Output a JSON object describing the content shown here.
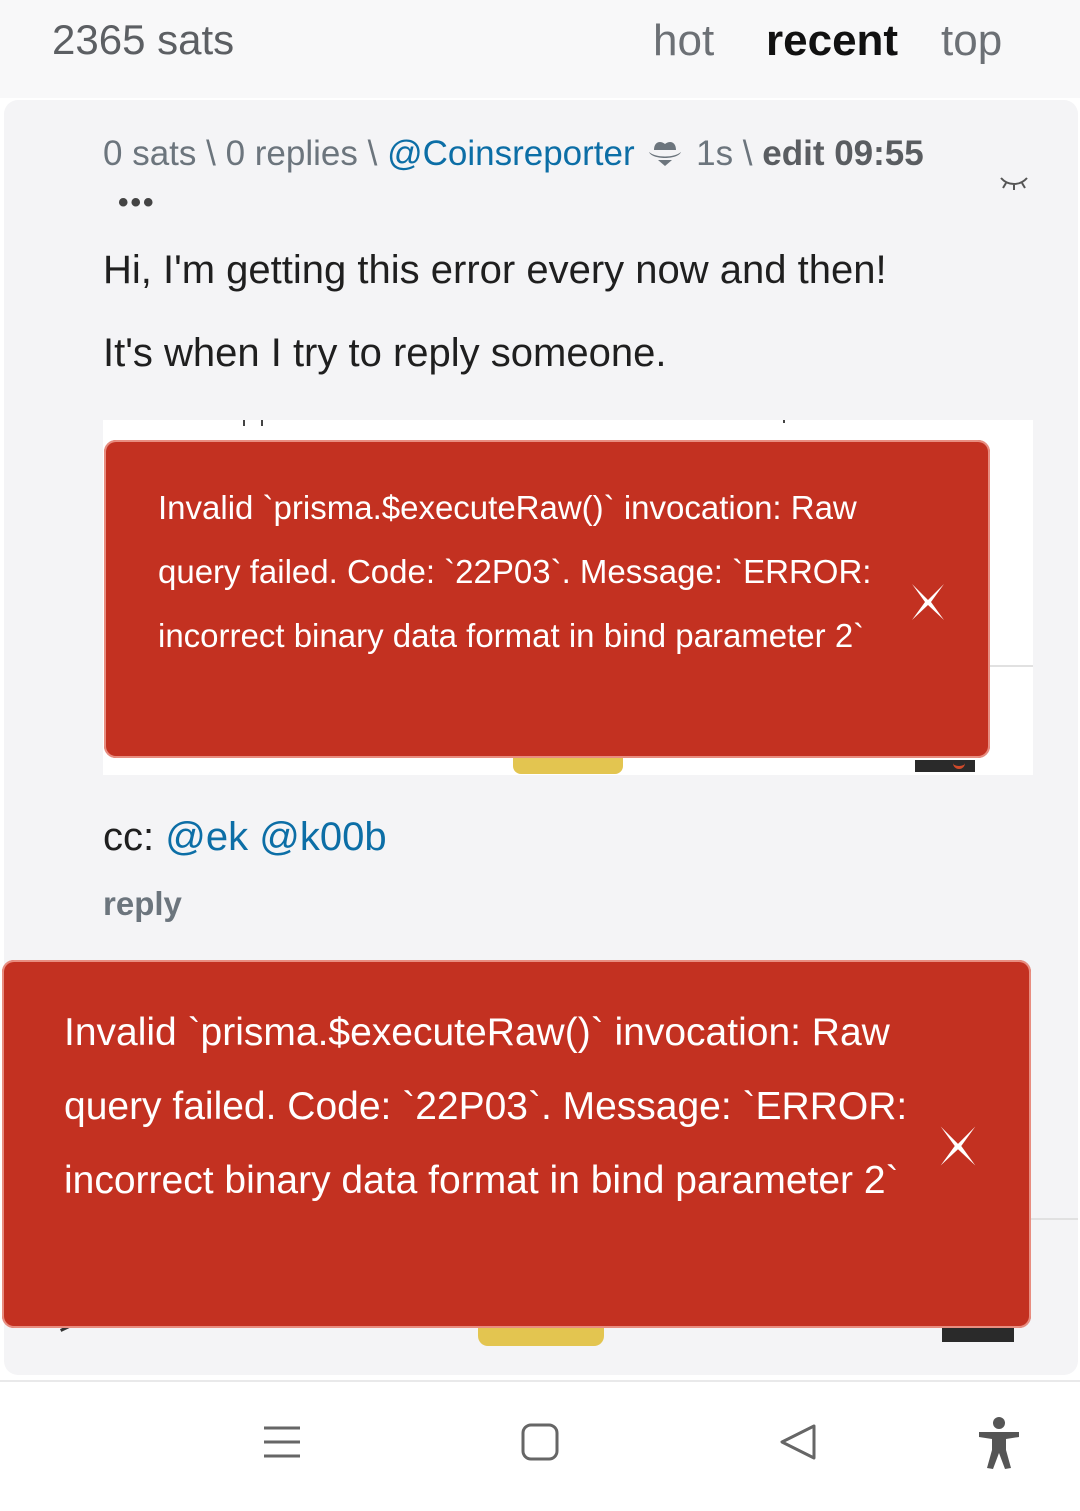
{
  "header": {
    "sats_total": "2365 sats",
    "tabs": [
      {
        "label": "hot",
        "active": false
      },
      {
        "label": "recent",
        "active": true
      },
      {
        "label": "top",
        "active": false
      }
    ]
  },
  "post": {
    "meta": {
      "sats": "0 sats",
      "sep1": " \\ ",
      "replies": "0 replies",
      "sep2": " \\ ",
      "author": "@Coinsreporter",
      "age": "1s",
      "sep3": " \\ ",
      "edit": "edit 09:55"
    },
    "more_label": "•••",
    "body_lines": [
      "Hi, I'm getting this error every now and then!",
      "It's when I try to reply someone."
    ],
    "cc_label": "cc: ",
    "mentions": [
      "@ek",
      "@k00b"
    ],
    "reply_label": "reply"
  },
  "toasts": [
    {
      "message": "Invalid `prisma.$executeRaw()` invocation: Raw query failed. Code: `22P03`. Message: `ERROR: incorrect binary data format in bind parameter 2`",
      "close": "✕"
    },
    {
      "message": "Invalid `prisma.$executeRaw()` invocation: Raw query failed. Code: `22P03`. Message: `ERROR: incorrect binary data format in bind parameter 2`",
      "close": "✕"
    }
  ],
  "colors": {
    "toast_bg": "#c33121",
    "link": "#0c6ea6",
    "card_bg": "#f4f4f6"
  },
  "icons": {
    "hat": "cowboy-hat-icon",
    "hide": "eye-closed-icon",
    "nav": [
      "menu-icon",
      "home-square-icon",
      "back-triangle-icon",
      "accessibility-icon"
    ]
  }
}
